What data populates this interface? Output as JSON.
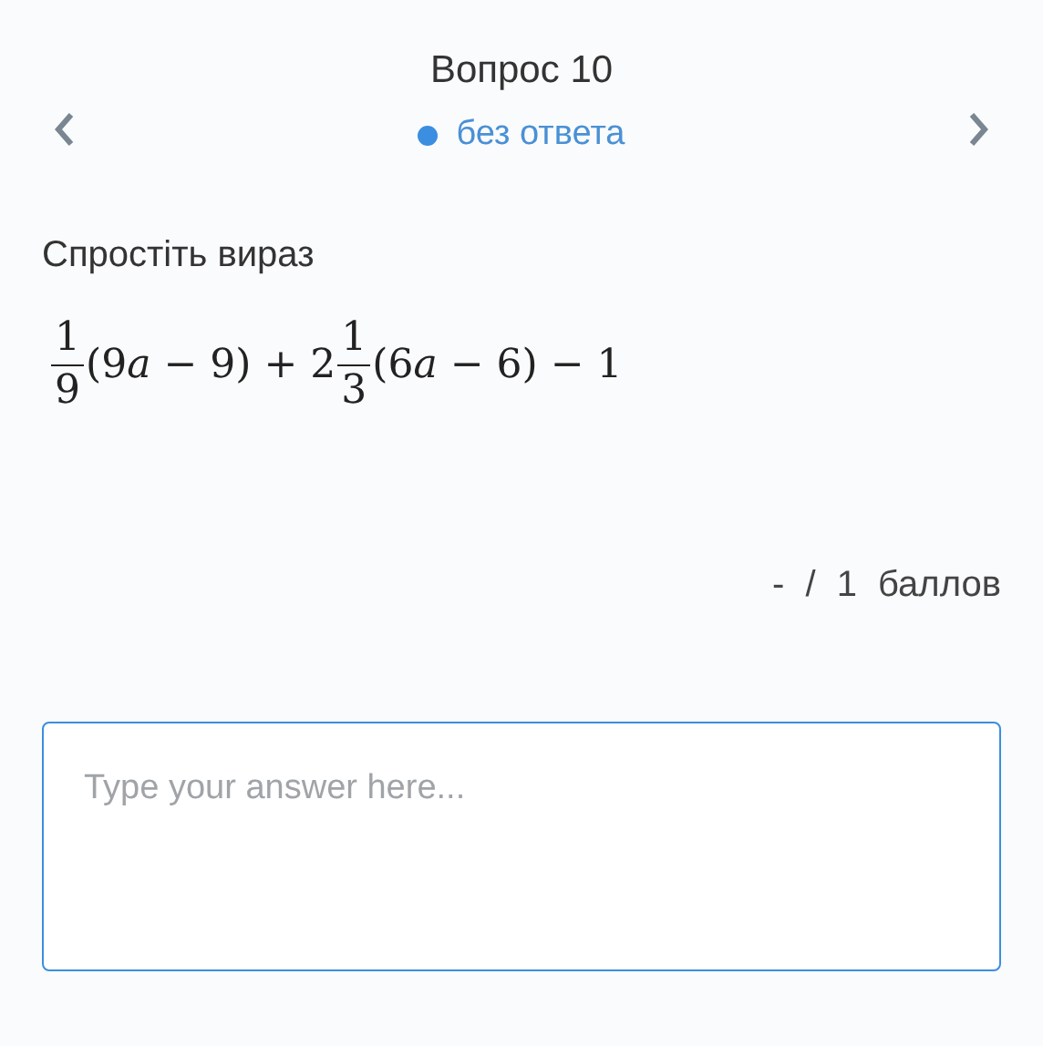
{
  "header": {
    "title": "Вопрос 10",
    "status": {
      "label": "без ответа",
      "color": "#3b8ee0"
    }
  },
  "question": {
    "prompt": "Спростіть вираз",
    "expression": [
      {
        "kind": "frac",
        "num": "1",
        "den": "9"
      },
      {
        "kind": "text",
        "text": "(9"
      },
      {
        "kind": "var",
        "text": "a"
      },
      {
        "kind": "text",
        "text": " − 9) + 2"
      },
      {
        "kind": "frac",
        "num": "1",
        "den": "3"
      },
      {
        "kind": "text",
        "text": "(6"
      },
      {
        "kind": "var",
        "text": "a"
      },
      {
        "kind": "text",
        "text": " − 6) − 1"
      }
    ]
  },
  "score": "- / 1 баллов",
  "answer": {
    "placeholder": "Type your answer here..."
  }
}
